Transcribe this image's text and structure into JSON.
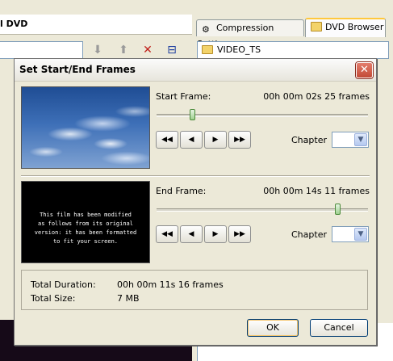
{
  "background": {
    "left_title": "l DVD",
    "tabs": [
      {
        "label": "Compression Settings",
        "icon": "wrench-icon",
        "active": false
      },
      {
        "label": "DVD Browser",
        "icon": "folder-icon",
        "active": true
      }
    ],
    "folder_path": "VIDEO_TS",
    "toolbar": [
      "arrow-down-icon",
      "arrow-up-icon",
      "delete-x-icon",
      "fit-icon"
    ]
  },
  "dialog": {
    "title": "Set Start/End Frames",
    "start": {
      "label": "Start Frame:",
      "value": "00h 00m 02s 25 frames",
      "position_fraction": 0.17,
      "chapter_label": "Chapter",
      "chapter_value": ""
    },
    "end": {
      "label": "End Frame:",
      "value": "00h 00m 14s 11 frames",
      "position_fraction": 0.85,
      "chapter_label": "Chapter",
      "chapter_value": "",
      "preview_text": [
        "This film has been modified",
        "as follows from its original",
        "version: it has been formatted",
        "to fit your screen."
      ]
    },
    "transport": {
      "rewind": "◀◀",
      "prev": "◀",
      "next": "▶",
      "forward": "▶▶"
    },
    "summary": {
      "duration_label": "Total Duration:",
      "duration_value": "00h 00m 11s 16 frames",
      "size_label": "Total Size:",
      "size_value": "7 MB"
    },
    "ok_label": "OK",
    "cancel_label": "Cancel",
    "close_label": "✕"
  }
}
